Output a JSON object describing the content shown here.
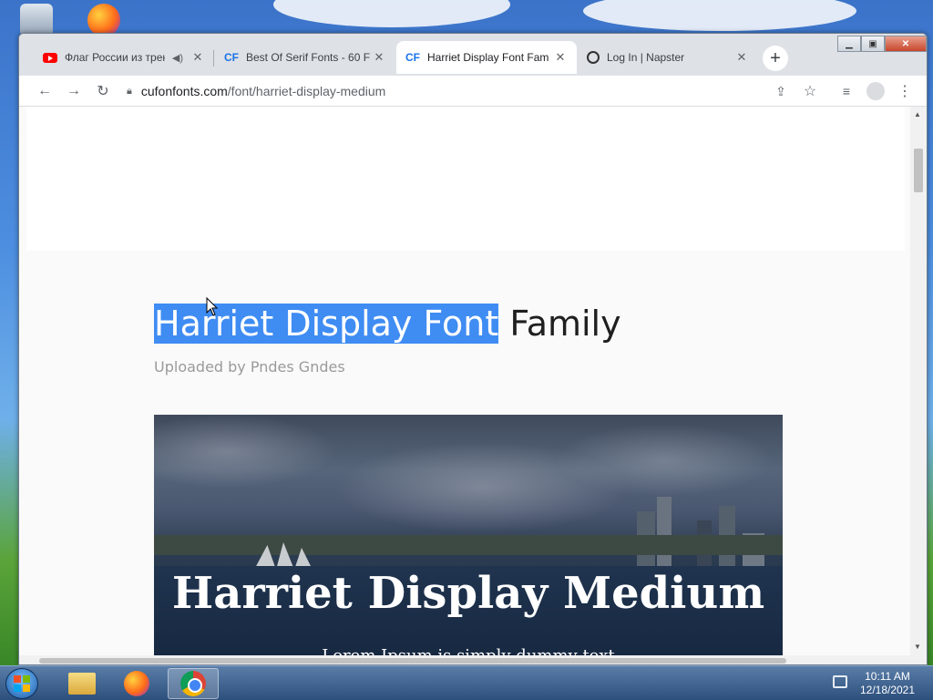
{
  "browser": {
    "tabs": [
      {
        "title": "Флаг России из трек",
        "favicon": "youtube-icon",
        "audio": true,
        "active": false
      },
      {
        "title": "Best Of Serif Fonts - 60 F",
        "favicon": "CF",
        "active": false
      },
      {
        "title": "Harriet Display Font Fam",
        "favicon": "CF",
        "active": true
      },
      {
        "title": "Log In | Napster",
        "favicon": "napster-icon",
        "active": false
      }
    ],
    "address": {
      "domain": "cufonfonts.com",
      "path": "/font/harriet-display-medium"
    },
    "colors": {
      "accent": "#1a73e8",
      "selection": "#3f8cf3"
    }
  },
  "page": {
    "title_selected": "Harriet Display Font",
    "title_rest": " Family",
    "uploader": "Uploaded by Pndes Gndes",
    "hero": {
      "title": "Harriet Display Medium",
      "subtitle": "Lorem Ipsum is simply dummy text"
    }
  },
  "taskbar": {
    "time": "10:11 AM",
    "date": "12/18/2021"
  }
}
